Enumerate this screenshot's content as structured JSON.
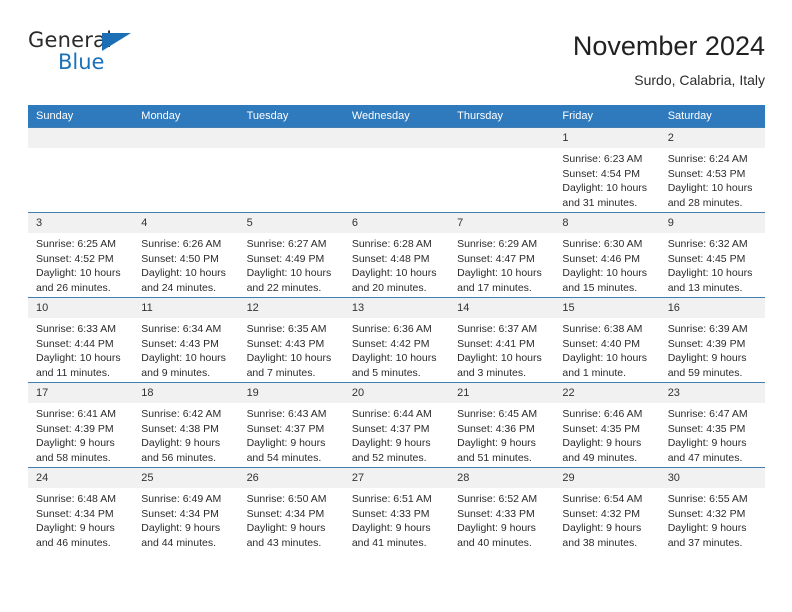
{
  "brand": {
    "name_part1": "General",
    "name_part2": "Blue",
    "triangle_color": "#1c6fb5",
    "blue_color": "#1c72ba"
  },
  "header": {
    "title": "November 2024",
    "subtitle": "Surdo, Calabria, Italy",
    "header_bg": "#2f79bd",
    "header_text_color": "#ffffff"
  },
  "weekdays": [
    "Sunday",
    "Monday",
    "Tuesday",
    "Wednesday",
    "Thursday",
    "Friday",
    "Saturday"
  ],
  "weeks": [
    [
      {
        "day": "",
        "sunrise": "",
        "sunset": "",
        "daylight1": "",
        "daylight2": ""
      },
      {
        "day": "",
        "sunrise": "",
        "sunset": "",
        "daylight1": "",
        "daylight2": ""
      },
      {
        "day": "",
        "sunrise": "",
        "sunset": "",
        "daylight1": "",
        "daylight2": ""
      },
      {
        "day": "",
        "sunrise": "",
        "sunset": "",
        "daylight1": "",
        "daylight2": ""
      },
      {
        "day": "",
        "sunrise": "",
        "sunset": "",
        "daylight1": "",
        "daylight2": ""
      },
      {
        "day": "1",
        "sunrise": "Sunrise: 6:23 AM",
        "sunset": "Sunset: 4:54 PM",
        "daylight1": "Daylight: 10 hours",
        "daylight2": "and 31 minutes."
      },
      {
        "day": "2",
        "sunrise": "Sunrise: 6:24 AM",
        "sunset": "Sunset: 4:53 PM",
        "daylight1": "Daylight: 10 hours",
        "daylight2": "and 28 minutes."
      }
    ],
    [
      {
        "day": "3",
        "sunrise": "Sunrise: 6:25 AM",
        "sunset": "Sunset: 4:52 PM",
        "daylight1": "Daylight: 10 hours",
        "daylight2": "and 26 minutes."
      },
      {
        "day": "4",
        "sunrise": "Sunrise: 6:26 AM",
        "sunset": "Sunset: 4:50 PM",
        "daylight1": "Daylight: 10 hours",
        "daylight2": "and 24 minutes."
      },
      {
        "day": "5",
        "sunrise": "Sunrise: 6:27 AM",
        "sunset": "Sunset: 4:49 PM",
        "daylight1": "Daylight: 10 hours",
        "daylight2": "and 22 minutes."
      },
      {
        "day": "6",
        "sunrise": "Sunrise: 6:28 AM",
        "sunset": "Sunset: 4:48 PM",
        "daylight1": "Daylight: 10 hours",
        "daylight2": "and 20 minutes."
      },
      {
        "day": "7",
        "sunrise": "Sunrise: 6:29 AM",
        "sunset": "Sunset: 4:47 PM",
        "daylight1": "Daylight: 10 hours",
        "daylight2": "and 17 minutes."
      },
      {
        "day": "8",
        "sunrise": "Sunrise: 6:30 AM",
        "sunset": "Sunset: 4:46 PM",
        "daylight1": "Daylight: 10 hours",
        "daylight2": "and 15 minutes."
      },
      {
        "day": "9",
        "sunrise": "Sunrise: 6:32 AM",
        "sunset": "Sunset: 4:45 PM",
        "daylight1": "Daylight: 10 hours",
        "daylight2": "and 13 minutes."
      }
    ],
    [
      {
        "day": "10",
        "sunrise": "Sunrise: 6:33 AM",
        "sunset": "Sunset: 4:44 PM",
        "daylight1": "Daylight: 10 hours",
        "daylight2": "and 11 minutes."
      },
      {
        "day": "11",
        "sunrise": "Sunrise: 6:34 AM",
        "sunset": "Sunset: 4:43 PM",
        "daylight1": "Daylight: 10 hours",
        "daylight2": "and 9 minutes."
      },
      {
        "day": "12",
        "sunrise": "Sunrise: 6:35 AM",
        "sunset": "Sunset: 4:43 PM",
        "daylight1": "Daylight: 10 hours",
        "daylight2": "and 7 minutes."
      },
      {
        "day": "13",
        "sunrise": "Sunrise: 6:36 AM",
        "sunset": "Sunset: 4:42 PM",
        "daylight1": "Daylight: 10 hours",
        "daylight2": "and 5 minutes."
      },
      {
        "day": "14",
        "sunrise": "Sunrise: 6:37 AM",
        "sunset": "Sunset: 4:41 PM",
        "daylight1": "Daylight: 10 hours",
        "daylight2": "and 3 minutes."
      },
      {
        "day": "15",
        "sunrise": "Sunrise: 6:38 AM",
        "sunset": "Sunset: 4:40 PM",
        "daylight1": "Daylight: 10 hours",
        "daylight2": "and 1 minute."
      },
      {
        "day": "16",
        "sunrise": "Sunrise: 6:39 AM",
        "sunset": "Sunset: 4:39 PM",
        "daylight1": "Daylight: 9 hours",
        "daylight2": "and 59 minutes."
      }
    ],
    [
      {
        "day": "17",
        "sunrise": "Sunrise: 6:41 AM",
        "sunset": "Sunset: 4:39 PM",
        "daylight1": "Daylight: 9 hours",
        "daylight2": "and 58 minutes."
      },
      {
        "day": "18",
        "sunrise": "Sunrise: 6:42 AM",
        "sunset": "Sunset: 4:38 PM",
        "daylight1": "Daylight: 9 hours",
        "daylight2": "and 56 minutes."
      },
      {
        "day": "19",
        "sunrise": "Sunrise: 6:43 AM",
        "sunset": "Sunset: 4:37 PM",
        "daylight1": "Daylight: 9 hours",
        "daylight2": "and 54 minutes."
      },
      {
        "day": "20",
        "sunrise": "Sunrise: 6:44 AM",
        "sunset": "Sunset: 4:37 PM",
        "daylight1": "Daylight: 9 hours",
        "daylight2": "and 52 minutes."
      },
      {
        "day": "21",
        "sunrise": "Sunrise: 6:45 AM",
        "sunset": "Sunset: 4:36 PM",
        "daylight1": "Daylight: 9 hours",
        "daylight2": "and 51 minutes."
      },
      {
        "day": "22",
        "sunrise": "Sunrise: 6:46 AM",
        "sunset": "Sunset: 4:35 PM",
        "daylight1": "Daylight: 9 hours",
        "daylight2": "and 49 minutes."
      },
      {
        "day": "23",
        "sunrise": "Sunrise: 6:47 AM",
        "sunset": "Sunset: 4:35 PM",
        "daylight1": "Daylight: 9 hours",
        "daylight2": "and 47 minutes."
      }
    ],
    [
      {
        "day": "24",
        "sunrise": "Sunrise: 6:48 AM",
        "sunset": "Sunset: 4:34 PM",
        "daylight1": "Daylight: 9 hours",
        "daylight2": "and 46 minutes."
      },
      {
        "day": "25",
        "sunrise": "Sunrise: 6:49 AM",
        "sunset": "Sunset: 4:34 PM",
        "daylight1": "Daylight: 9 hours",
        "daylight2": "and 44 minutes."
      },
      {
        "day": "26",
        "sunrise": "Sunrise: 6:50 AM",
        "sunset": "Sunset: 4:34 PM",
        "daylight1": "Daylight: 9 hours",
        "daylight2": "and 43 minutes."
      },
      {
        "day": "27",
        "sunrise": "Sunrise: 6:51 AM",
        "sunset": "Sunset: 4:33 PM",
        "daylight1": "Daylight: 9 hours",
        "daylight2": "and 41 minutes."
      },
      {
        "day": "28",
        "sunrise": "Sunrise: 6:52 AM",
        "sunset": "Sunset: 4:33 PM",
        "daylight1": "Daylight: 9 hours",
        "daylight2": "and 40 minutes."
      },
      {
        "day": "29",
        "sunrise": "Sunrise: 6:54 AM",
        "sunset": "Sunset: 4:32 PM",
        "daylight1": "Daylight: 9 hours",
        "daylight2": "and 38 minutes."
      },
      {
        "day": "30",
        "sunrise": "Sunrise: 6:55 AM",
        "sunset": "Sunset: 4:32 PM",
        "daylight1": "Daylight: 9 hours",
        "daylight2": "and 37 minutes."
      }
    ]
  ]
}
